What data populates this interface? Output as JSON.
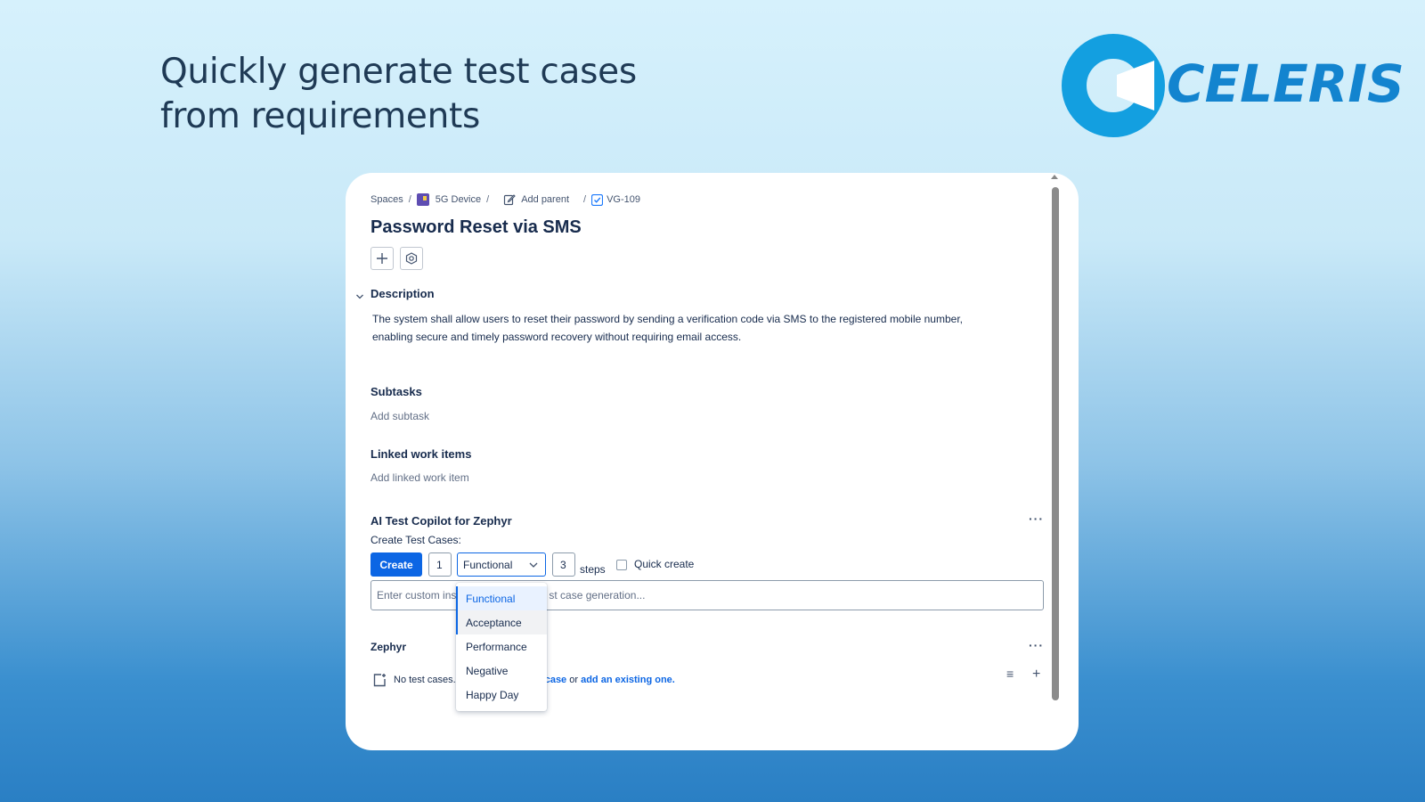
{
  "headline": {
    "line1": "Quickly generate test cases",
    "line2": "from requirements"
  },
  "logo": {
    "text": "CELERIS",
    "color": "#1384cf"
  },
  "breadcrumb": {
    "spaces": "Spaces",
    "project": "5G Device",
    "add_parent": "Add parent",
    "issue_key": "VG-109",
    "separator": "/"
  },
  "issue": {
    "title": "Password Reset via SMS",
    "description_heading": "Description",
    "description_line1": "The system shall allow users to reset their password by sending a verification code via SMS to the registered mobile number,",
    "description_line2": "enabling secure and timely password recovery without requiring email access.",
    "subtasks_heading": "Subtasks",
    "add_subtask": "Add subtask",
    "linked_heading": "Linked work items",
    "add_linked": "Add linked work item"
  },
  "copilot": {
    "heading": "AI Test Copilot for Zephyr",
    "create_label": "Create Test Cases:",
    "create_button": "Create",
    "count_value": "1",
    "type_value": "Functional",
    "steps_value": "3",
    "steps_label": "steps",
    "quick_create_label": "Quick create",
    "quick_create_checked": false,
    "custom_placeholder_left": "Enter custom ins",
    "custom_placeholder_right": "st case generation...",
    "type_options": [
      "Functional",
      "Acceptance",
      "Performance",
      "Negative",
      "Happy Day"
    ],
    "more": "···"
  },
  "zephyr": {
    "heading": "Zephyr",
    "no_test_cases": "No test cases.",
    "case_link": "case",
    "or_text": " or ",
    "existing_link": "add an existing one.",
    "more": "···",
    "list_icon": "≡",
    "add_icon": "+"
  },
  "colors": {
    "accent": "#0c66e4",
    "heading": "#1f3a55"
  }
}
